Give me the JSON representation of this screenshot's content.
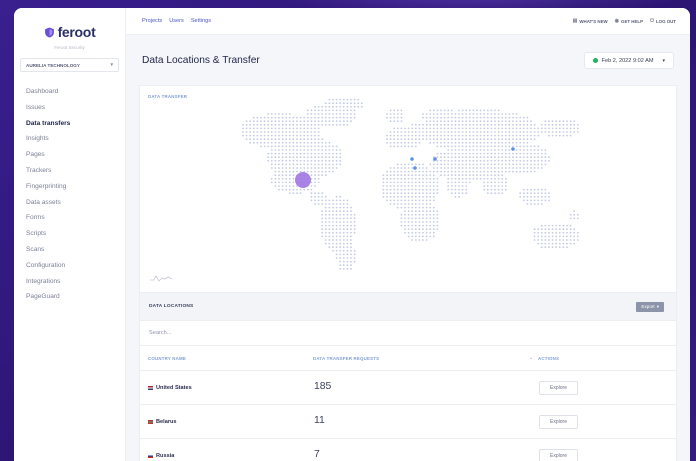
{
  "brand": {
    "name": "feroot",
    "tagline": "Feroot Security",
    "accent": "#6b4fd8"
  },
  "org_selector": {
    "value": "AURELIA TECHNOLOGY"
  },
  "sidebar": {
    "items": [
      {
        "label": "Dashboard",
        "active": false
      },
      {
        "label": "Issues",
        "active": false
      },
      {
        "label": "Data transfers",
        "active": true
      },
      {
        "label": "Insights",
        "active": false
      },
      {
        "label": "Pages",
        "active": false
      },
      {
        "label": "Trackers",
        "active": false
      },
      {
        "label": "Fingerprinting",
        "active": false
      },
      {
        "label": "Data assets",
        "active": false
      },
      {
        "label": "Forms",
        "active": false
      },
      {
        "label": "Scripts",
        "active": false
      },
      {
        "label": "Scans",
        "active": false
      },
      {
        "label": "Configuration",
        "active": false
      },
      {
        "label": "Integrations",
        "active": false
      },
      {
        "label": "PageGuard",
        "active": false
      }
    ]
  },
  "topbar": {
    "links": [
      "Projects",
      "Users",
      "Settings"
    ],
    "actions": [
      {
        "label": "WHAT'S NEW",
        "icon": "news-icon"
      },
      {
        "label": "GET HELP",
        "icon": "help-icon"
      },
      {
        "label": "LOG OUT",
        "icon": "logout-icon"
      }
    ]
  },
  "page": {
    "title": "Data Locations & Transfer",
    "date": "Feb 2, 2022 9:02 AM",
    "status_color": "#1fb55c"
  },
  "map": {
    "label": "DATA TRANSFER",
    "dot_color": "#c3cbe6",
    "marker_color": "#5b92e5",
    "bubble_color": "#9b6fe0"
  },
  "locations": {
    "title": "DATA LOCATIONS",
    "export_label": "Export",
    "search_placeholder": "Search...",
    "columns": [
      "COUNTRY NAME",
      "DATA TRANSFER REQUESTS",
      "ACTIONS"
    ],
    "rows": [
      {
        "country": "United States",
        "requests": "185",
        "action": "Explore"
      },
      {
        "country": "Belarus",
        "requests": "11",
        "action": "Explore"
      },
      {
        "country": "Russia",
        "requests": "7",
        "action": "Explore"
      }
    ]
  }
}
